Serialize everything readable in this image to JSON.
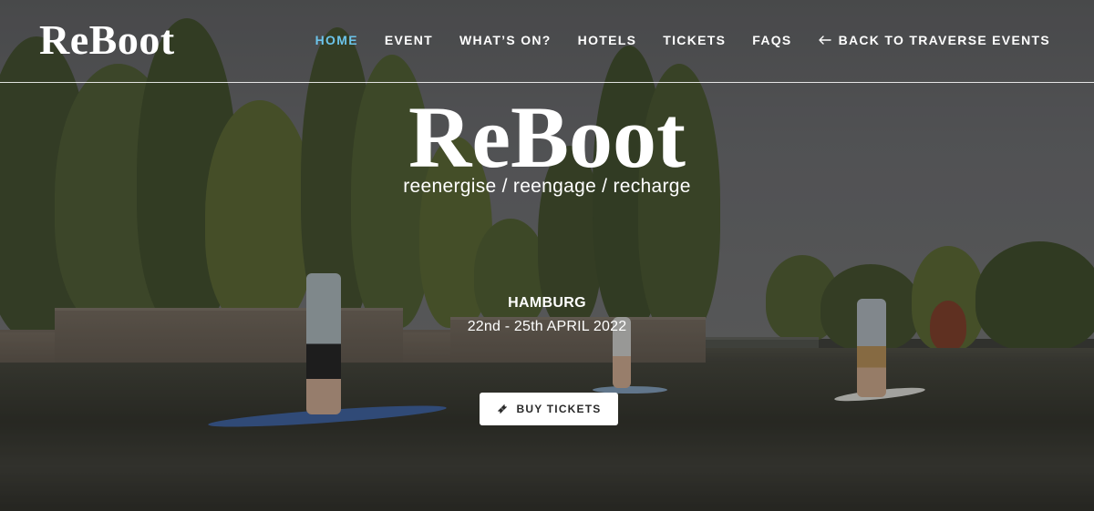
{
  "header": {
    "logo": "ReBoot",
    "nav": [
      {
        "label": "HOME",
        "active": true
      },
      {
        "label": "EVENT",
        "active": false
      },
      {
        "label": "WHAT’S ON?",
        "active": false
      },
      {
        "label": "HOTELS",
        "active": false
      },
      {
        "label": "TICKETS",
        "active": false
      },
      {
        "label": "FAQS",
        "active": false
      }
    ],
    "back_link": {
      "label": "BACK TO TRAVERSE EVENTS",
      "icon": "arrow-left-icon"
    }
  },
  "hero": {
    "title": "ReBoot",
    "tagline": "reenergise / reengage / recharge",
    "city": "HAMBURG",
    "dates": "22nd - 25th APRIL 2022",
    "cta": {
      "label": "BUY TICKETS",
      "icon": "ticket-icon"
    }
  },
  "colors": {
    "accent": "#6cc4ea",
    "text": "#ffffff",
    "button_bg": "#ffffff",
    "button_text": "#2a2a2a"
  }
}
